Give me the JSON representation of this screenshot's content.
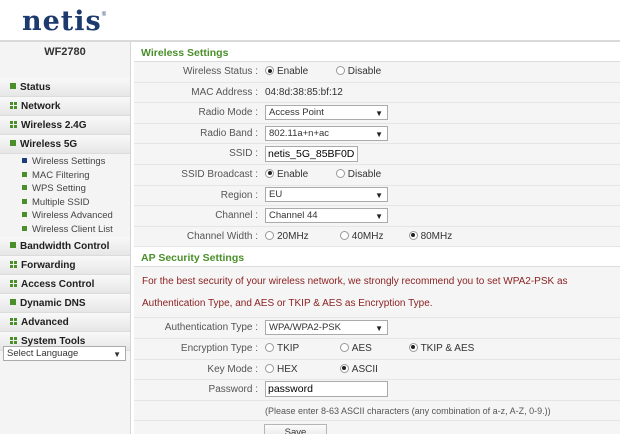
{
  "brand": {
    "logo": "netis",
    "trademark": "®"
  },
  "sidebar": {
    "model": "WF2780",
    "items": [
      {
        "label": "Status"
      },
      {
        "label": "Network"
      },
      {
        "label": "Wireless 2.4G"
      },
      {
        "label": "Wireless 5G"
      }
    ],
    "submenu": [
      {
        "label": "Wireless Settings"
      },
      {
        "label": "MAC Filtering"
      },
      {
        "label": "WPS Setting"
      },
      {
        "label": "Multiple SSID"
      },
      {
        "label": "Wireless Advanced"
      },
      {
        "label": "Wireless Client List"
      }
    ],
    "items_after": [
      {
        "label": "Bandwidth Control"
      },
      {
        "label": "Forwarding"
      },
      {
        "label": "Access Control"
      },
      {
        "label": "Dynamic DNS"
      },
      {
        "label": "Advanced"
      },
      {
        "label": "System Tools"
      }
    ],
    "language": "Select Language"
  },
  "wireless": {
    "title": "Wireless Settings",
    "status": {
      "label": "Wireless Status :",
      "opt1": "Enable",
      "opt2": "Disable",
      "selected": "Enable"
    },
    "mac": {
      "label": "MAC Address :",
      "value": "04:8d:38:85:bf:12"
    },
    "radio_mode": {
      "label": "Radio Mode :",
      "value": "Access Point"
    },
    "radio_band": {
      "label": "Radio Band :",
      "value": "802.11a+n+ac"
    },
    "ssid": {
      "label": "SSID :",
      "value": "netis_5G_85BF0D"
    },
    "broadcast": {
      "label": "SSID Broadcast :",
      "opt1": "Enable",
      "opt2": "Disable",
      "selected": "Enable"
    },
    "region": {
      "label": "Region :",
      "value": "EU"
    },
    "channel": {
      "label": "Channel :",
      "value": "Channel 44"
    },
    "width": {
      "label": "Channel Width :",
      "opt1": "20MHz",
      "opt2": "40MHz",
      "opt3": "80MHz",
      "selected": "80MHz"
    }
  },
  "security": {
    "title": "AP Security Settings",
    "notice1": "For the best security of your wireless network, we strongly recommend you to set WPA2-PSK as",
    "notice2": "Authentication Type, and AES or TKIP & AES as Encryption Type.",
    "auth": {
      "label": "Authentication Type :",
      "value": "WPA/WPA2-PSK"
    },
    "enc": {
      "label": "Encryption Type :",
      "opt1": "TKIP",
      "opt2": "AES",
      "opt3": "TKIP & AES",
      "selected": "TKIP & AES"
    },
    "keymode": {
      "label": "Key Mode :",
      "opt1": "HEX",
      "opt2": "ASCII",
      "selected": "ASCII"
    },
    "password": {
      "label": "Password :",
      "value": "password"
    },
    "hint": "(Please enter 8-63 ASCII characters (any combination of a-z, A-Z, 0-9.))",
    "save": "Save"
  },
  "colors": {
    "accent": "#4a8f2a",
    "brand": "#1d3a6e",
    "notice": "#8a1f1f"
  }
}
